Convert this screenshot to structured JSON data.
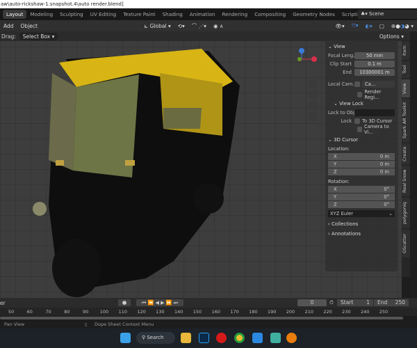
{
  "title": "aw\\auto-rickshaw-1.snapshot.4\\auto render.blend]",
  "workspaces": [
    "Layout",
    "Modeling",
    "Sculpting",
    "UV Editing",
    "Texture Paint",
    "Shading",
    "Animation",
    "Rendering",
    "Compositing",
    "Geometry Nodes",
    "Scripting",
    "+"
  ],
  "scene": "Scene",
  "header": {
    "add": "Add",
    "object": "Object",
    "orientation": "Global",
    "options": "Options"
  },
  "toolbar": {
    "drag_label": "Drag:",
    "drag_value": "Select Box"
  },
  "npanel": {
    "view_title": "View",
    "focal_label": "Focal Leng...",
    "focal": "50 mm",
    "clip_start_label": "Clip Start",
    "clip_start": "0.1 m",
    "end_label": "End",
    "end": "10300001 m",
    "local_cam_label": "Local Cam...",
    "local_cam": "Ca...",
    "render_region": "Render Regi...",
    "view_lock_title": "View Lock",
    "lock_to_obj": "Lock to Obj",
    "lock_label": "Lock",
    "to_3d_cursor": "To 3D Cursor",
    "camera_to_view": "Camera to Vi...",
    "cursor_title": "3D Cursor",
    "location_label": "Location:",
    "rotation_label": "Rotation:",
    "location": [
      {
        "axis": "X",
        "value": "0 m"
      },
      {
        "axis": "Y",
        "value": "0 m"
      },
      {
        "axis": "Z",
        "value": "0 m"
      }
    ],
    "rotation": [
      {
        "axis": "X",
        "value": "0°"
      },
      {
        "axis": "Y",
        "value": "0°"
      },
      {
        "axis": "Z",
        "value": "0°"
      }
    ],
    "rotation_mode": "XYZ Euler",
    "collections": "Collections",
    "annotations": "Annotations"
  },
  "side_tabs": [
    "Item",
    "Tool",
    "View",
    "Spark AR Toolkit",
    "Create",
    "Real Snow",
    "polygoniq",
    "GScatter"
  ],
  "timeline": {
    "left_label": "er",
    "current_frame": "0",
    "start_label": "Start",
    "start": "1",
    "end_label": "End",
    "end": "250",
    "ticks": [
      "50",
      "60",
      "70",
      "80",
      "90",
      "100",
      "110",
      "120",
      "130",
      "140",
      "150",
      "160",
      "170",
      "180",
      "190",
      "200",
      "210",
      "220",
      "230",
      "240",
      "250"
    ]
  },
  "status": {
    "left": "Pan View",
    "middle": "Dope Sheet Context Menu"
  },
  "taskbar": {
    "search": "Search"
  }
}
